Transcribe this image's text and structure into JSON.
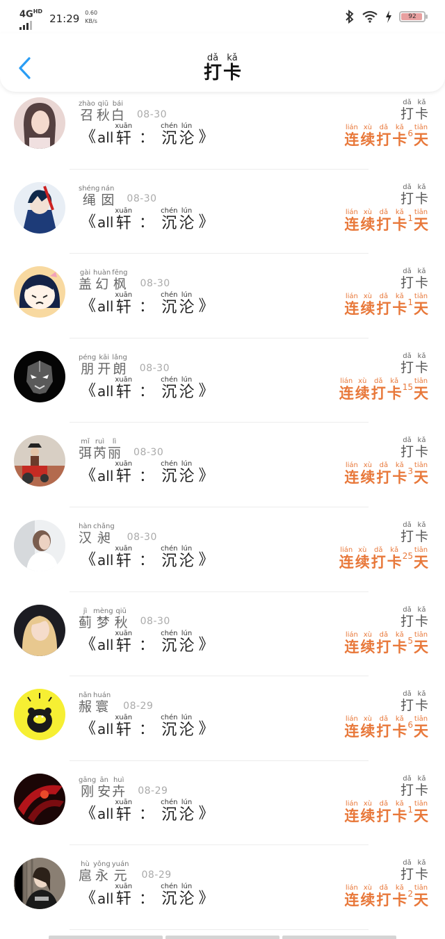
{
  "status": {
    "network": "4G",
    "network_sup": "HD",
    "time": "21:29",
    "speed_value": "0.60",
    "speed_unit": "KB/s",
    "battery": "92"
  },
  "header": {
    "title": [
      {
        "py": "dǎ",
        "hz": "打"
      },
      {
        "py": "kǎ",
        "hz": "卡"
      }
    ],
    "back_icon": "chevron-left-icon"
  },
  "labels": {
    "quote_open": "《",
    "quote_close": "》",
    "latin": "all",
    "colon": "：",
    "xuan": {
      "py": "xuān",
      "hz": "轩"
    },
    "chen": {
      "py": "chén",
      "hz": "沉"
    },
    "lun": {
      "py": "lún",
      "hz": "沦"
    },
    "checkin": [
      {
        "py": "dǎ",
        "hz": "打"
      },
      {
        "py": "kǎ",
        "hz": "卡"
      }
    ],
    "streak_prefix": [
      {
        "py": "lián",
        "hz": "连"
      },
      {
        "py": "xù",
        "hz": "续"
      },
      {
        "py": "dǎ",
        "hz": "打"
      },
      {
        "py": "kǎ",
        "hz": "卡"
      }
    ],
    "streak_suffix": {
      "py": "tiān",
      "hz": "天"
    }
  },
  "accent_color": "#e8783a",
  "entries": [
    {
      "name": [
        {
          "py": "zhào",
          "hz": "召"
        },
        {
          "py": "qiū",
          "hz": "秋"
        },
        {
          "py": "bái",
          "hz": "白"
        }
      ],
      "date": "08-30",
      "days": "6",
      "avatar": "avatar-girl"
    },
    {
      "name": [
        {
          "py": "shéng",
          "hz": "绳"
        },
        {
          "py": "nán",
          "hz": "囡"
        }
      ],
      "date": "08-30",
      "days": "1",
      "avatar": "avatar-anime-boy"
    },
    {
      "name": [
        {
          "py": "gài",
          "hz": "盖"
        },
        {
          "py": "huàn",
          "hz": "幻"
        },
        {
          "py": "fēng",
          "hz": "枫"
        }
      ],
      "date": "08-30",
      "days": "1",
      "avatar": "avatar-cartoon-girl"
    },
    {
      "name": [
        {
          "py": "péng",
          "hz": "朋"
        },
        {
          "py": "kāi",
          "hz": "开"
        },
        {
          "py": "lǎng",
          "hz": "朗"
        }
      ],
      "date": "08-30",
      "days": "15",
      "avatar": "avatar-mask"
    },
    {
      "name": [
        {
          "py": "mǐ",
          "hz": "弭"
        },
        {
          "py": "ruì",
          "hz": "芮"
        },
        {
          "py": "lì",
          "hz": "丽"
        }
      ],
      "date": "08-30",
      "days": "3",
      "avatar": "avatar-tractor"
    },
    {
      "name": [
        {
          "py": "hàn",
          "hz": "汉"
        },
        {
          "py": "chǎng",
          "hz": "昶"
        }
      ],
      "date": "08-30",
      "days": "25",
      "avatar": "avatar-woman-back"
    },
    {
      "name": [
        {
          "py": "jì",
          "hz": "蓟"
        },
        {
          "py": "mèng",
          "hz": "梦"
        },
        {
          "py": "qiū",
          "hz": "秋"
        }
      ],
      "date": "08-30",
      "days": "5",
      "avatar": "avatar-blonde"
    },
    {
      "name": [
        {
          "py": "nǎn",
          "hz": "赧"
        },
        {
          "py": "huán",
          "hz": "寰"
        }
      ],
      "date": "08-29",
      "days": "6",
      "avatar": "avatar-bear"
    },
    {
      "name": [
        {
          "py": "gāng",
          "hz": "刚"
        },
        {
          "py": "ān",
          "hz": "安"
        },
        {
          "py": "huì",
          "hz": "卉"
        }
      ],
      "date": "08-29",
      "days": "1",
      "avatar": "avatar-red-abstract"
    },
    {
      "name": [
        {
          "py": "hù",
          "hz": "扈"
        },
        {
          "py": "yǒng",
          "hz": "永"
        },
        {
          "py": "yuán",
          "hz": "元"
        }
      ],
      "date": "08-29",
      "days": "2",
      "avatar": "avatar-woman-wall"
    }
  ]
}
